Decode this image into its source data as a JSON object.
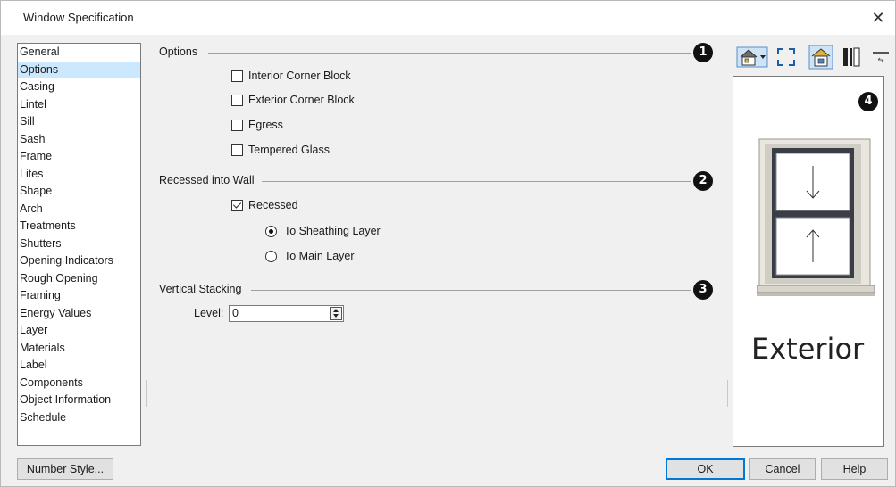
{
  "window": {
    "title": "Window Specification"
  },
  "nav": {
    "items": [
      "General",
      "Options",
      "Casing",
      "Lintel",
      "Sill",
      "Sash",
      "Frame",
      "Lites",
      "Shape",
      "Arch",
      "Treatments",
      "Shutters",
      "Opening Indicators",
      "Rough Opening",
      "Framing",
      "Energy Values",
      "Layer",
      "Materials",
      "Label",
      "Components",
      "Object Information",
      "Schedule"
    ],
    "selected": "Options"
  },
  "options": {
    "label": "Options",
    "badge": "1",
    "checkboxes": [
      {
        "label": "Interior Corner Block",
        "checked": false
      },
      {
        "label": "Exterior Corner Block",
        "checked": false
      },
      {
        "label": "Egress",
        "checked": false
      },
      {
        "label": "Tempered Glass",
        "checked": false
      }
    ]
  },
  "recessed": {
    "label": "Recessed into Wall",
    "badge": "2",
    "checkbox": {
      "label": "Recessed",
      "checked": true
    },
    "radios": [
      {
        "label": "To Sheathing Layer",
        "selected": true
      },
      {
        "label": "To Main Layer",
        "selected": false
      }
    ]
  },
  "stacking": {
    "label": "Vertical Stacking",
    "badge": "3",
    "level_label": "Level:",
    "level_value": "0"
  },
  "preview": {
    "badge": "4",
    "caption": "Exterior",
    "toolbar_icons": [
      "view-house-dropdown-icon",
      "fill-window-icon",
      "color-view-icon",
      "wall-section-icon",
      "toggle-panel-icon"
    ]
  },
  "buttons": {
    "number_style": "Number Style...",
    "ok": "OK",
    "cancel": "Cancel",
    "help": "Help"
  },
  "colors": {
    "selection": "#cce8ff",
    "accent": "#0078d7"
  }
}
